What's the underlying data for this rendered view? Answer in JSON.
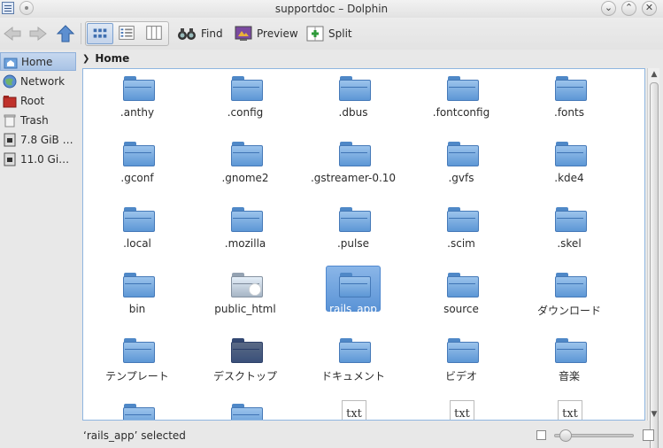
{
  "window": {
    "title": "supportdoc – Dolphin"
  },
  "toolbar": {
    "find_label": "Find",
    "preview_label": "Preview",
    "split_label": "Split"
  },
  "places": [
    {
      "label": "Home",
      "icon": "home-folder-icon"
    },
    {
      "label": "Network",
      "icon": "network-globe-icon"
    },
    {
      "label": "Root",
      "icon": "root-folder-icon"
    },
    {
      "label": "Trash",
      "icon": "trash-icon"
    },
    {
      "label": "7.8 GiB …",
      "icon": "drive-icon"
    },
    {
      "label": "11.0 Gi…",
      "icon": "drive-icon"
    }
  ],
  "breadcrumb": {
    "current": "Home"
  },
  "files": [
    {
      "name": ".anthy",
      "type": "folder"
    },
    {
      "name": ".config",
      "type": "folder"
    },
    {
      "name": ".dbus",
      "type": "folder"
    },
    {
      "name": ".fontconfig",
      "type": "folder"
    },
    {
      "name": ".fonts",
      "type": "folder"
    },
    {
      "name": ".gconf",
      "type": "folder"
    },
    {
      "name": ".gnome2",
      "type": "folder"
    },
    {
      "name": ".gstreamer-0.10",
      "type": "folder"
    },
    {
      "name": ".gvfs",
      "type": "folder"
    },
    {
      "name": ".kde4",
      "type": "folder"
    },
    {
      "name": ".local",
      "type": "folder"
    },
    {
      "name": ".mozilla",
      "type": "folder"
    },
    {
      "name": ".pulse",
      "type": "folder"
    },
    {
      "name": ".scim",
      "type": "folder"
    },
    {
      "name": ".skel",
      "type": "folder"
    },
    {
      "name": "bin",
      "type": "folder"
    },
    {
      "name": "public_html",
      "type": "web-folder"
    },
    {
      "name": "rails_app",
      "type": "folder",
      "selected": true
    },
    {
      "name": "source",
      "type": "folder"
    },
    {
      "name": "ダウンロード",
      "type": "folder"
    },
    {
      "name": "テンプレート",
      "type": "folder"
    },
    {
      "name": "デスクトップ",
      "type": "desktop-folder"
    },
    {
      "name": "ドキュメント",
      "type": "folder"
    },
    {
      "name": "ビデオ",
      "type": "folder"
    },
    {
      "name": "音楽",
      "type": "folder"
    },
    {
      "name": "",
      "type": "folder"
    },
    {
      "name": "",
      "type": "folder"
    },
    {
      "name": "",
      "type": "text-file",
      "icon_text": "txt"
    },
    {
      "name": "",
      "type": "text-file",
      "icon_text": "txt"
    },
    {
      "name": "",
      "type": "text-file",
      "icon_text": "txt"
    }
  ],
  "status": {
    "text": "‘rails_app’ selected"
  },
  "colors": {
    "selection": "#5a93d6",
    "folder": "#6ea2dc",
    "view_border": "#8fb6e0"
  }
}
